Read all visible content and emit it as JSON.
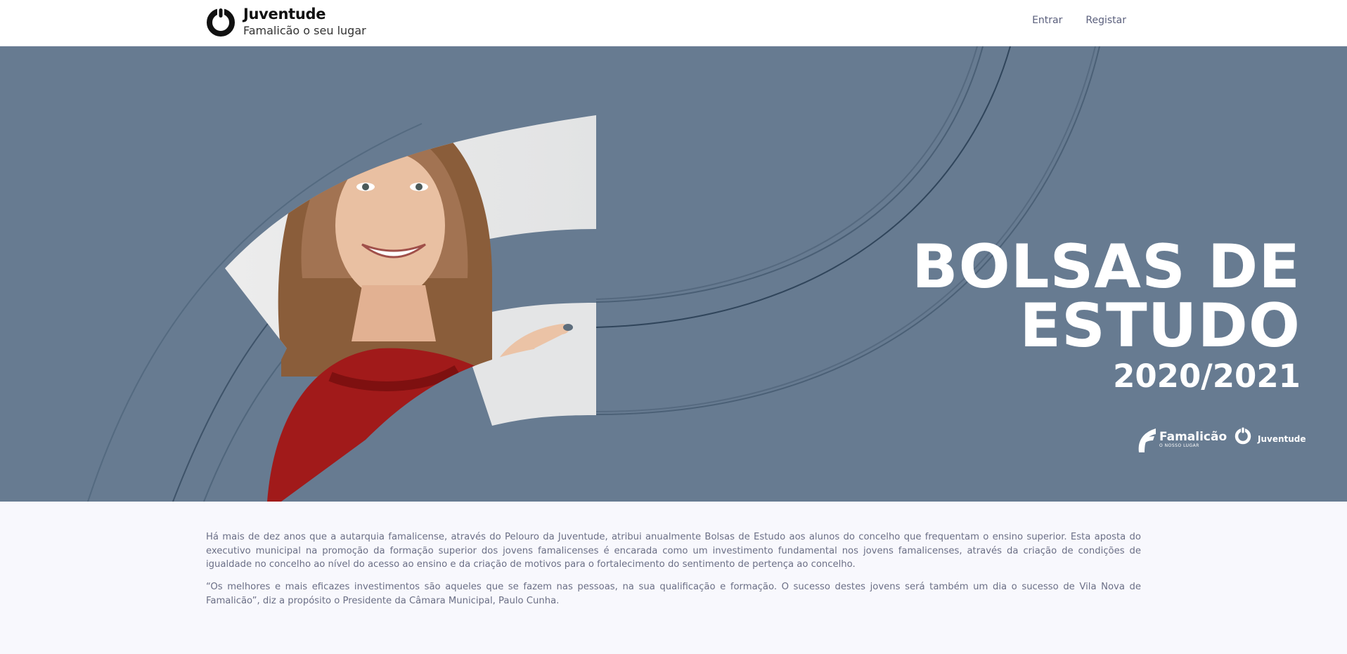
{
  "header": {
    "logo": {
      "title": "Juventude",
      "subtitle": "Famalicão o seu lugar",
      "icon": "juventude-power-logo-icon"
    },
    "nav": [
      {
        "label": "Entrar"
      },
      {
        "label": "Registar"
      }
    ]
  },
  "hero": {
    "title_line1": "BOLSAS DE",
    "title_line2": "ESTUDO",
    "year": "2020/2021",
    "image": "smiling-student-pointing-photo",
    "partners": [
      {
        "name": "Famalicão",
        "tagline": "O NOSSO LUGAR",
        "icon": "famalicao-f-logo-icon"
      },
      {
        "name": "Juventude",
        "icon": "juventude-power-logo-icon"
      }
    ],
    "colors": {
      "background": "#677b91",
      "text": "#ffffff"
    }
  },
  "content": {
    "paragraph1": "Há mais de dez anos que a autarquia famalicense, através do Pelouro da Juventude, atribui anualmente Bolsas de Estudo aos alunos do concelho que frequentam o ensino superior. Esta aposta do executivo municipal na promoção da formação superior dos jovens famalicenses  é encarada como um investimento fundamental nos jovens famalicenses, através da criação de condições de igualdade no concelho ao nível do acesso ao ensino e da criação de  motivos para o fortalecimento do sentimento de pertença ao concelho.",
    "paragraph2": " “Os melhores e mais eficazes investimentos são aqueles que se fazem nas pessoas, na sua qualificação e formação. O sucesso destes jovens será também um dia o sucesso de Vila Nova de Famalicão”, diz a propósito o Presidente da Câmara Municipal, Paulo Cunha."
  }
}
